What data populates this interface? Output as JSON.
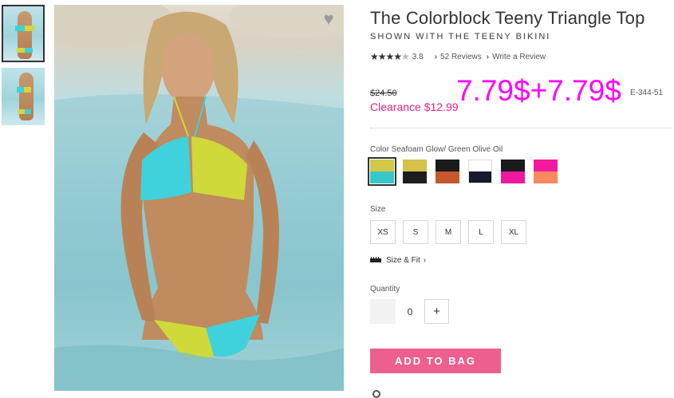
{
  "thumbnails": [
    {
      "alt": "front view",
      "selected": true
    },
    {
      "alt": "side view",
      "selected": false
    }
  ],
  "product": {
    "title": "The Colorblock Teeny Triangle Top",
    "subtitle": "SHOWN WITH THE TEENY BIKINI",
    "rating": {
      "stars": "★★★★",
      "empty_star": "★",
      "value": "3.8",
      "reviews_label": "52 Reviews",
      "write_review_label": "Write a Review",
      "chevron": "›"
    },
    "old_price": "$24.50",
    "clearance_price": "Clearance $12.99",
    "overlay_price": "7.79$+7.79$",
    "item_number": "E-344-51"
  },
  "color": {
    "label": "Color Seafoam Glow/ Green Olive Oil",
    "swatches": [
      {
        "top": "#d1c84a",
        "bottom": "#36c8c8",
        "selected": true
      },
      {
        "top": "#d4c14a",
        "bottom": "#1e1e1e",
        "selected": false
      },
      {
        "top": "#1a1a1a",
        "bottom": "#c4592f",
        "selected": false
      },
      {
        "top": "#ffffff",
        "bottom": "#171a2a",
        "selected": false
      },
      {
        "top": "#1a1a1a",
        "bottom": "#ec1aa0",
        "selected": false
      },
      {
        "top": "#f21aa0",
        "bottom": "#f78a5e",
        "selected": false
      }
    ]
  },
  "size": {
    "label": "Size",
    "options": [
      "XS",
      "S",
      "M",
      "L",
      "XL"
    ],
    "fit_label": "Size & Fit",
    "fit_chevron": "›"
  },
  "quantity": {
    "label": "Quantity",
    "value": "0",
    "plus": "+"
  },
  "add_to_bag": "ADD TO BAG",
  "icons": {
    "wishlist": "heart-icon",
    "size_fit": "ruler-icon"
  },
  "colors": {
    "accent_pink": "#e6208a",
    "button_pink": "#ec5f8f",
    "overlay_magenta": "#ff00ff"
  }
}
